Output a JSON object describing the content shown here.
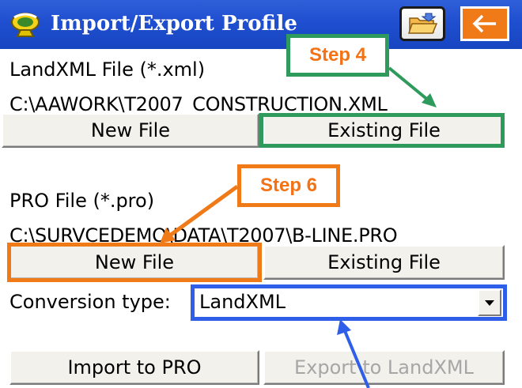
{
  "window": {
    "title": "Import/Export Profile"
  },
  "landxml": {
    "label": "LandXML File (*.xml)",
    "path": "C:\\AAWORK\\T2007_CONSTRUCTION.XML",
    "new_file_label": "New File",
    "existing_file_label": "Existing File"
  },
  "pro": {
    "label": "PRO File (*.pro)",
    "path": "C:\\SURVCEDEMO\\DATA\\T2007\\B-LINE.PRO",
    "new_file_label": "New File",
    "existing_file_label": "Existing File"
  },
  "conversion": {
    "label": "Conversion type:",
    "selected": "LandXML"
  },
  "actions": {
    "import_label": "Import to PRO",
    "export_label": "Export to LandXML"
  },
  "annotations": {
    "step4": "Step 4",
    "step6": "Step 6"
  },
  "icons": {
    "app": "satellite-dish-icon",
    "folder": "open-folder-icon",
    "back": "back-arrow-icon"
  },
  "colors": {
    "titlebar": "#1f4fd0",
    "step4_highlight": "#2e9a5c",
    "step6_highlight": "#f07a18",
    "conversion_highlight": "#2f5fe8",
    "back_button": "#f07a18"
  }
}
